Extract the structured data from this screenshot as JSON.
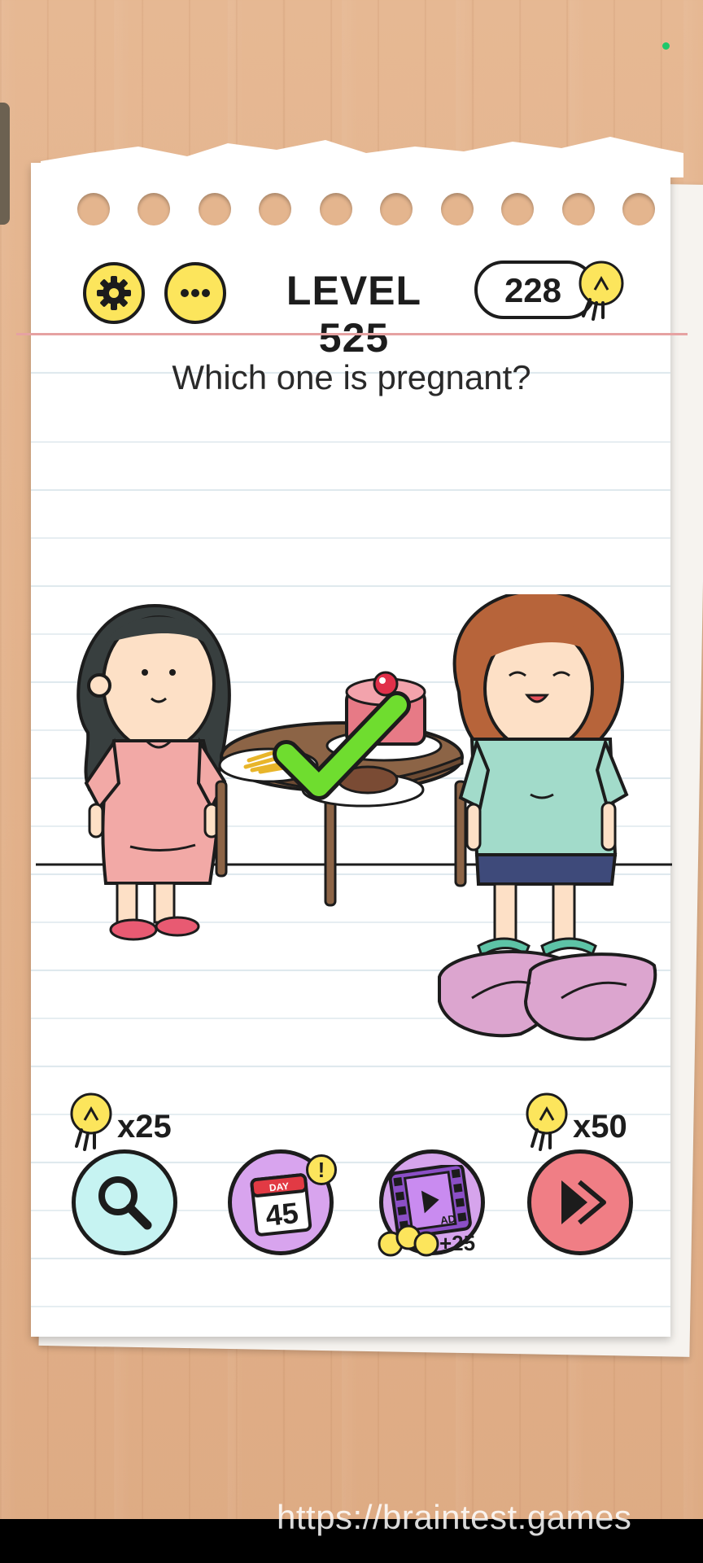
{
  "level_label": "LEVEL 525",
  "hint_count": "228",
  "question": "Which one is pregnant?",
  "tools": {
    "magnifier_cost": "x25",
    "skip_cost": "x50",
    "calendar_label": "DAY",
    "calendar_day": "45",
    "calendar_alert": "!",
    "ad_label": "AD",
    "ad_reward": "+25"
  },
  "watermark": "https://braintest.games",
  "colors": {
    "yellow": "#fce55c",
    "magnifier_bg": "#c6f3f2",
    "calendar_bg": "#d8a4ee",
    "ad_bg": "#d6a4ec",
    "skip_bg": "#f07e85",
    "check": "#6fdd2f"
  },
  "icons": [
    "gear-icon",
    "more-icon",
    "lightbulb-icon",
    "search-icon",
    "calendar-icon",
    "film-icon",
    "skip-icon"
  ]
}
